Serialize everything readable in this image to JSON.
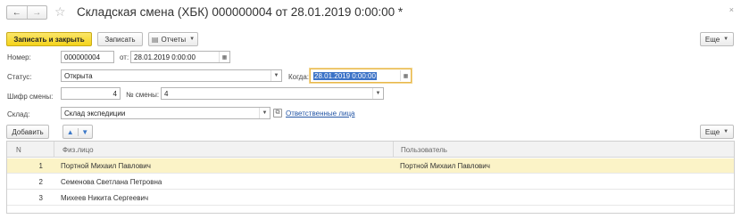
{
  "window": {
    "title": "Складская смена (ХБК) 000000004 от 28.01.2019 0:00:00 *",
    "back_icon": "←",
    "forward_icon": "→",
    "favorite_icon": "☆",
    "close_icon": "×"
  },
  "toolbar": {
    "save_close_label": "Записать и закрыть",
    "save_label": "Записать",
    "reports_label": "Отчеты",
    "more_label": "Еще"
  },
  "form": {
    "number_label": "Номер:",
    "number_value": "000000004",
    "from_label": "от:",
    "from_value": "28.01.2019  0:00:00",
    "status_label": "Статус:",
    "status_value": "Открыта",
    "when_label": "Когда:",
    "when_value": "28.01.2019  0:00:00",
    "shift_code_label": "Шифр смены:",
    "shift_code_value": "4",
    "shift_no_label": "№ смены:",
    "shift_no_value": "4",
    "warehouse_label": "Склад:",
    "warehouse_value": "Склад экспедиции",
    "responsible_link": "Ответственные лица"
  },
  "table_toolbar": {
    "add_label": "Добавить",
    "up_icon": "🡅",
    "down_icon": "🡇",
    "more_label": "Еще"
  },
  "table": {
    "columns": [
      "N",
      "Физ.лицо",
      "Пользователь"
    ],
    "rows": [
      {
        "n": "1",
        "person": "Портной Михаил Павлович",
        "user": "Портной Михаил Павлович"
      },
      {
        "n": "2",
        "person": "Семенова Светлана Петровна",
        "user": ""
      },
      {
        "n": "3",
        "person": "Михеев Никита Сергеевич",
        "user": ""
      }
    ]
  },
  "colors": {
    "primary_button": "#f4d31b",
    "selected_row": "#fbf3c7",
    "link": "#2456a6",
    "selection": "#3c73c7"
  }
}
